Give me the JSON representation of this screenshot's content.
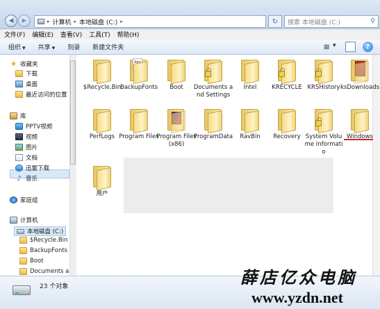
{
  "address_bar": {
    "breadcrumbs": [
      "计算机",
      "本地磁盘 (C:)"
    ],
    "search_placeholder": "搜索 本地磁盘 (C:)"
  },
  "menu": [
    "文件(F)",
    "编辑(E)",
    "查看(V)",
    "工具(T)",
    "帮助(H)"
  ],
  "toolbar": {
    "organize": "组织",
    "share": "共享",
    "burn": "刻录",
    "new_folder": "新建文件夹"
  },
  "nav": {
    "favorites": "收藏夹",
    "downloads": "下载",
    "desktop": "桌面",
    "recent": "最近访问的位置",
    "libraries": "库",
    "pptv": "PPTV视频",
    "videos": "视频",
    "pictures": "图片",
    "documents": "文档",
    "thunder": "迅雷下载",
    "music": "音乐",
    "homegroup": "家庭组",
    "computer": "计算机",
    "local_disk": "本地磁盘 (C:)",
    "recycle": "$Recycle.Bin",
    "backupfonts": "BackupFonts",
    "boot": "Boot",
    "docs_and": "Documents and"
  },
  "files": [
    {
      "name": "$Recycle.Bin"
    },
    {
      "name": "BackupFonts"
    },
    {
      "name": "Boot"
    },
    {
      "name": "Documents and Settings"
    },
    {
      "name": "Intel"
    },
    {
      "name": "KRECYCLE"
    },
    {
      "name": "KRSHistory"
    },
    {
      "name": "ksDownloads"
    },
    {
      "name": "PerfLogs"
    },
    {
      "name": "Program Files"
    },
    {
      "name": "Program Files (x86)"
    },
    {
      "name": "ProgramData"
    },
    {
      "name": "RavBin"
    },
    {
      "name": "Recovery"
    },
    {
      "name": "System Volume Informatio"
    },
    {
      "name": "Windows"
    },
    {
      "name": "用户"
    }
  ],
  "status": {
    "item_count": "23 个对象"
  },
  "watermark": {
    "title": "薛店亿众电脑",
    "url": "www.yzdn.net"
  },
  "colors": {
    "annotation_underline": "#d0282b",
    "selection": "#d9e8f7"
  }
}
